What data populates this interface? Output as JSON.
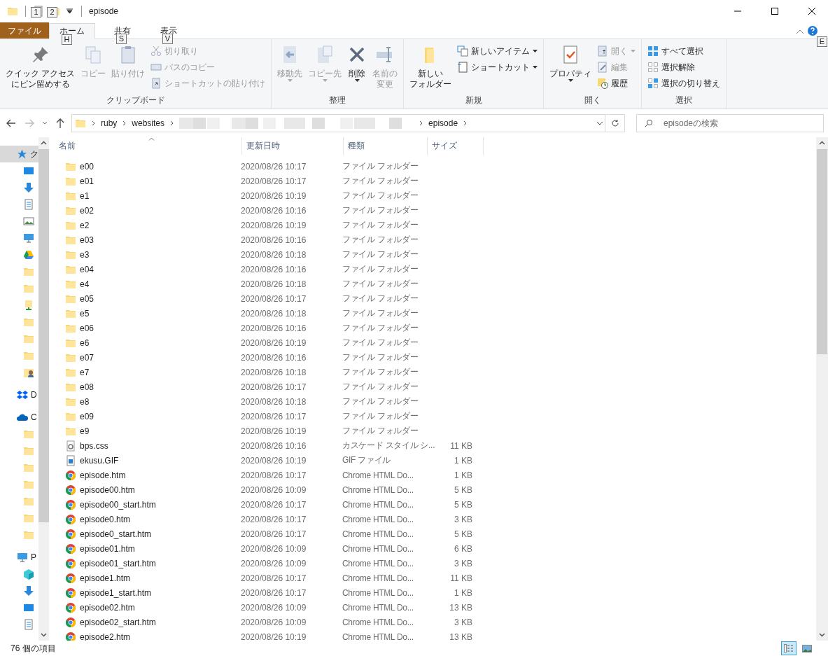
{
  "title_bar": {
    "keytips": [
      "1",
      "2"
    ],
    "title": "episode"
  },
  "ribbon_tabs": [
    {
      "label": "ファイル",
      "kind": "file",
      "selected": false
    },
    {
      "label": "ホーム",
      "kind": "tab",
      "keytip": "H",
      "selected": true
    },
    {
      "label": "共有",
      "kind": "tab",
      "keytip": "S",
      "selected": false
    },
    {
      "label": "表示",
      "kind": "tab",
      "keytip": "V",
      "selected": false
    }
  ],
  "help_keytip": "E",
  "ribbon": {
    "groups": [
      {
        "label": "クリップボード",
        "items": [
          {
            "kind": "large",
            "lines": [
              "クイック アクセス",
              "にピン留めする"
            ],
            "disabled": false,
            "dropdown": false
          },
          {
            "kind": "large",
            "lines": [
              "コピー"
            ],
            "disabled": true,
            "dropdown": false
          },
          {
            "kind": "large",
            "lines": [
              "貼り付け"
            ],
            "disabled": true,
            "dropdown": false
          },
          {
            "kind": "small",
            "label": "切り取り",
            "disabled": true,
            "dropdown": false
          },
          {
            "kind": "small",
            "label": "パスのコピー",
            "disabled": true,
            "dropdown": false
          },
          {
            "kind": "small",
            "label": "ショートカットの貼り付け",
            "disabled": true,
            "dropdown": false
          }
        ]
      },
      {
        "label": "整理",
        "items": [
          {
            "kind": "large",
            "lines": [
              "移動先"
            ],
            "disabled": true,
            "dropdown": true
          },
          {
            "kind": "large",
            "lines": [
              "コピー先"
            ],
            "disabled": true,
            "dropdown": true
          },
          {
            "kind": "large",
            "lines": [
              "削除"
            ],
            "disabled": false,
            "dropdown": true
          },
          {
            "kind": "large",
            "lines": [
              "名前の",
              "変更"
            ],
            "disabled": true,
            "dropdown": false
          }
        ]
      },
      {
        "label": "新規",
        "items": [
          {
            "kind": "large",
            "lines": [
              "新しい",
              "フォルダー"
            ],
            "disabled": false,
            "dropdown": false
          },
          {
            "kind": "small",
            "label": "新しいアイテム",
            "disabled": false,
            "dropdown": true
          },
          {
            "kind": "small",
            "label": "ショートカット",
            "disabled": false,
            "dropdown": true
          }
        ]
      },
      {
        "label": "開く",
        "items": [
          {
            "kind": "large",
            "lines": [
              "プロパティ"
            ],
            "disabled": false,
            "dropdown": true
          },
          {
            "kind": "small",
            "label": "開く",
            "disabled": true,
            "dropdown": true
          },
          {
            "kind": "small",
            "label": "編集",
            "disabled": true,
            "dropdown": false
          },
          {
            "kind": "small",
            "label": "履歴",
            "disabled": false,
            "dropdown": false
          }
        ]
      },
      {
        "label": "選択",
        "items": [
          {
            "kind": "small",
            "label": "すべて選択",
            "disabled": false,
            "dropdown": false
          },
          {
            "kind": "small",
            "label": "選択解除",
            "disabled": false,
            "dropdown": false
          },
          {
            "kind": "small",
            "label": "選択の切り替え",
            "disabled": false,
            "dropdown": false
          }
        ]
      }
    ]
  },
  "address_bar": {
    "segments": [
      {
        "kind": "text",
        "label": "ruby"
      },
      {
        "kind": "text",
        "label": "websites"
      },
      {
        "kind": "blurred"
      },
      {
        "kind": "text",
        "label": "episode"
      }
    ]
  },
  "search": {
    "placeholder": "episodeの検索"
  },
  "navigation_pane": {
    "items": [
      {
        "label": "ク",
        "kind": "quick-access",
        "selected": true,
        "children": [
          {
            "kind": "desktop",
            "selected": false
          },
          {
            "kind": "downloads",
            "selected": false
          },
          {
            "kind": "documents",
            "selected": false
          },
          {
            "kind": "pictures",
            "selected": false
          },
          {
            "kind": "pc",
            "selected": false
          },
          {
            "kind": "drive",
            "selected": false
          },
          {
            "kind": "folder",
            "selected": false
          },
          {
            "kind": "folder",
            "selected": false
          },
          {
            "kind": "network-folder",
            "selected": false
          },
          {
            "kind": "folder",
            "selected": false
          },
          {
            "kind": "folder",
            "selected": false
          },
          {
            "kind": "folder",
            "selected": false
          },
          {
            "kind": "shared-folder",
            "selected": false
          }
        ]
      },
      {
        "label": "D",
        "kind": "dropbox",
        "selected": false
      },
      {
        "label": "C",
        "kind": "onedrive",
        "selected": false,
        "children": [
          {
            "kind": "folder",
            "selected": false
          },
          {
            "kind": "folder",
            "selected": false
          },
          {
            "kind": "folder",
            "selected": false
          },
          {
            "kind": "folder",
            "selected": false
          },
          {
            "kind": "folder",
            "selected": false
          },
          {
            "kind": "folder",
            "selected": false
          },
          {
            "kind": "folder",
            "selected": false
          }
        ]
      },
      {
        "label": "P",
        "kind": "pc",
        "selected": false,
        "children": [
          {
            "kind": "cube",
            "selected": false
          },
          {
            "kind": "downloads",
            "selected": false
          },
          {
            "kind": "desktop",
            "selected": false
          },
          {
            "kind": "documents",
            "selected": false
          }
        ]
      }
    ]
  },
  "file_list": {
    "columns": [
      {
        "label": "名前",
        "sorted": true
      },
      {
        "label": "更新日時",
        "sorted": false
      },
      {
        "label": "種類",
        "sorted": false
      },
      {
        "label": "サイズ",
        "sorted": false
      }
    ],
    "rows": [
      {
        "kind": "folder",
        "name": "e00",
        "date": "2020/08/26 10:17",
        "type": "ファイル フォルダー"
      },
      {
        "kind": "folder",
        "name": "e01",
        "date": "2020/08/26 10:17",
        "type": "ファイル フォルダー"
      },
      {
        "kind": "folder",
        "name": "e1",
        "date": "2020/08/26 10:19",
        "type": "ファイル フォルダー"
      },
      {
        "kind": "folder",
        "name": "e02",
        "date": "2020/08/26 10:16",
        "type": "ファイル フォルダー"
      },
      {
        "kind": "folder",
        "name": "e2",
        "date": "2020/08/26 10:19",
        "type": "ファイル フォルダー"
      },
      {
        "kind": "folder",
        "name": "e03",
        "date": "2020/08/26 10:16",
        "type": "ファイル フォルダー"
      },
      {
        "kind": "folder",
        "name": "e3",
        "date": "2020/08/26 10:18",
        "type": "ファイル フォルダー"
      },
      {
        "kind": "folder",
        "name": "e04",
        "date": "2020/08/26 10:16",
        "type": "ファイル フォルダー"
      },
      {
        "kind": "folder",
        "name": "e4",
        "date": "2020/08/26 10:18",
        "type": "ファイル フォルダー"
      },
      {
        "kind": "folder",
        "name": "e05",
        "date": "2020/08/26 10:17",
        "type": "ファイル フォルダー"
      },
      {
        "kind": "folder",
        "name": "e5",
        "date": "2020/08/26 10:18",
        "type": "ファイル フォルダー"
      },
      {
        "kind": "folder",
        "name": "e06",
        "date": "2020/08/26 10:16",
        "type": "ファイル フォルダー"
      },
      {
        "kind": "folder",
        "name": "e6",
        "date": "2020/08/26 10:19",
        "type": "ファイル フォルダー"
      },
      {
        "kind": "folder",
        "name": "e07",
        "date": "2020/08/26 10:16",
        "type": "ファイル フォルダー"
      },
      {
        "kind": "folder",
        "name": "e7",
        "date": "2020/08/26 10:18",
        "type": "ファイル フォルダー"
      },
      {
        "kind": "folder",
        "name": "e08",
        "date": "2020/08/26 10:17",
        "type": "ファイル フォルダー"
      },
      {
        "kind": "folder",
        "name": "e8",
        "date": "2020/08/26 10:18",
        "type": "ファイル フォルダー"
      },
      {
        "kind": "folder",
        "name": "e09",
        "date": "2020/08/26 10:17",
        "type": "ファイル フォルダー"
      },
      {
        "kind": "folder",
        "name": "e9",
        "date": "2020/08/26 10:19",
        "type": "ファイル フォルダー"
      },
      {
        "kind": "stylesheet",
        "name": "bps.css",
        "date": "2020/08/26 10:16",
        "type": "カスケード スタイル シ...",
        "size": "11 KB"
      },
      {
        "kind": "image",
        "name": "ekusu.GIF",
        "date": "2020/08/26 10:19",
        "type": "GIF ファイル",
        "size": "1 KB"
      },
      {
        "kind": "chrome",
        "name": "episode.htm",
        "date": "2020/08/26 10:17",
        "type": "Chrome HTML Do...",
        "size": "1 KB"
      },
      {
        "kind": "chrome",
        "name": "episode00.htm",
        "date": "2020/08/26 10:09",
        "type": "Chrome HTML Do...",
        "size": "5 KB"
      },
      {
        "kind": "chrome",
        "name": "episode00_start.htm",
        "date": "2020/08/26 10:17",
        "type": "Chrome HTML Do...",
        "size": "5 KB"
      },
      {
        "kind": "chrome",
        "name": "episode0.htm",
        "date": "2020/08/26 10:17",
        "type": "Chrome HTML Do...",
        "size": "3 KB"
      },
      {
        "kind": "chrome",
        "name": "episode0_start.htm",
        "date": "2020/08/26 10:17",
        "type": "Chrome HTML Do...",
        "size": "5 KB"
      },
      {
        "kind": "chrome",
        "name": "episode01.htm",
        "date": "2020/08/26 10:09",
        "type": "Chrome HTML Do...",
        "size": "6 KB"
      },
      {
        "kind": "chrome",
        "name": "episode01_start.htm",
        "date": "2020/08/26 10:09",
        "type": "Chrome HTML Do...",
        "size": "3 KB"
      },
      {
        "kind": "chrome",
        "name": "episode1.htm",
        "date": "2020/08/26 10:17",
        "type": "Chrome HTML Do...",
        "size": "11 KB"
      },
      {
        "kind": "chrome",
        "name": "episode1_start.htm",
        "date": "2020/08/26 10:17",
        "type": "Chrome HTML Do...",
        "size": "1 KB"
      },
      {
        "kind": "chrome",
        "name": "episode02.htm",
        "date": "2020/08/26 10:09",
        "type": "Chrome HTML Do...",
        "size": "13 KB"
      },
      {
        "kind": "chrome",
        "name": "episode02_start.htm",
        "date": "2020/08/26 10:09",
        "type": "Chrome HTML Do...",
        "size": "3 KB"
      },
      {
        "kind": "chrome",
        "name": "episode2.htm",
        "date": "2020/08/26 10:19",
        "type": "Chrome HTML Do...",
        "size": "13 KB"
      }
    ]
  },
  "status_bar": {
    "item_count": "76 個の項目",
    "views": [
      {
        "kind": "details",
        "selected": true
      },
      {
        "kind": "large-icons",
        "selected": false
      }
    ]
  }
}
